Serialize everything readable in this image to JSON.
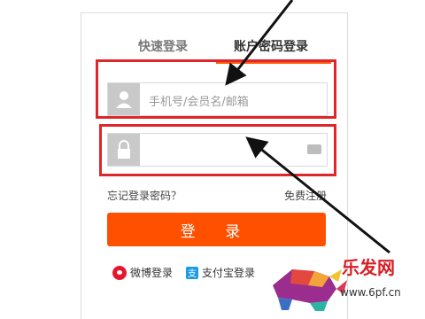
{
  "tabs": {
    "quick_login": "快速登录",
    "account_login": "账户密码登录"
  },
  "fields": {
    "username_placeholder": "手机号/会员名/邮箱",
    "password_placeholder": ""
  },
  "links": {
    "forgot_password": "忘记登录密码？",
    "register": "免费注册"
  },
  "login_button": "登 录",
  "third_party": {
    "weibo": "微博登录",
    "alipay": "支付宝登录"
  },
  "watermark": {
    "brand": "乐发网",
    "url": "www.6pf.cn"
  },
  "colors": {
    "accent": "#ff5000",
    "highlight": "#e0262a",
    "arrow": "#111111"
  }
}
